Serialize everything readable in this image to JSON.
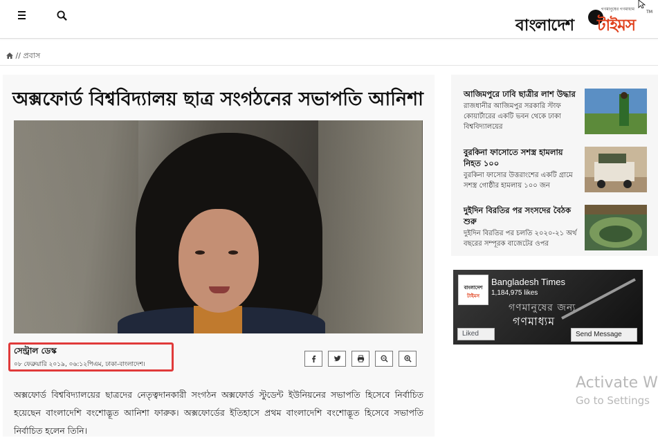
{
  "header": {
    "menu_icon": "hamburger-icon",
    "search_icon": "search-icon",
    "logo_tagline": "গণমানুষের গণমাধ্যম",
    "logo_part1": "বাংলাদেশ",
    "logo_part2": "টাইমস",
    "logo_tm": "TM"
  },
  "breadcrumb": {
    "home_icon": "home-icon",
    "separator": "//",
    "section": "প্রবাস"
  },
  "article": {
    "headline": "অক্সফোর্ড বিশ্ববিদ্যালয় ছাত্র সংগঠনের সভাপতি আনিশা",
    "author": "সেন্ট্রাল ডেস্ক",
    "dateline": "০৮ ফেব্রুয়ারি ২০১৯, ০৬:১২পিএম, ঢাকা-বাংলাদেশ।",
    "body": "অক্সফোর্ড বিশ্ববিদ্যালয়ের ছাত্রদের নেতৃত্বদানকারী সংগঠন অক্সফোর্ড স্টুডেন্ট ইউনিয়নের সভাপতি হিসেবে নির্বাচিত হয়েছেন বাংলাদেশি বংশোদ্ভূত আনিশা ফারুক। অক্সফোর্ডের ইতিহাসে প্রথম বাংলাদেশি বংশোদ্ভূত হিসেবে সভাপতি নির্বাচিত হলেন তিনি।",
    "share_buttons": [
      "facebook-icon",
      "twitter-icon",
      "print-icon",
      "zoom-out-icon",
      "zoom-in-icon"
    ]
  },
  "sidebar": {
    "news": [
      {
        "title": "আজিমপুরে ঢাবি ছাত্রীর লাশ উদ্ধার",
        "summary": "রাজধানীর আজিমপুর সরকারি স্টাফ কোয়ার্টারের একটি ভবন থেকে ঢাকা বিশ্ববিদ্যালয়ের"
      },
      {
        "title": "বুরকিনা ফাসোতে সশস্ত্র হামলায় নিহত ১০০",
        "summary": "বুরকিনা ফাসোর উত্তরাংশের একটি গ্রামে সশস্ত্র গোষ্ঠীর হামলায় ১০০ জন"
      },
      {
        "title": "দুইদিন বিরতির পর সংসদের বৈঠক শুরু",
        "summary": "দুইদিন বিরতির পর চলতি ২০২০-২১ অর্থ বছরের সম্পূরক বাজেটের ওপর"
      }
    ]
  },
  "facebook_widget": {
    "page_name": "Bangladesh Times",
    "likes": "1,184,975 likes",
    "slogan_line1": "গণমানুষের জন্য",
    "slogan_line2": "গণমাধ্যম",
    "liked_label": "Liked",
    "send_label": "Send Message",
    "avatar_line1": "বাংলাদেশ",
    "avatar_line2": "টাইমস"
  },
  "watermark": {
    "line1": "Activate W",
    "line2": "Go to Settings"
  },
  "colors": {
    "brand_red": "#e0401c",
    "highlight_box": "#e03a3a"
  }
}
